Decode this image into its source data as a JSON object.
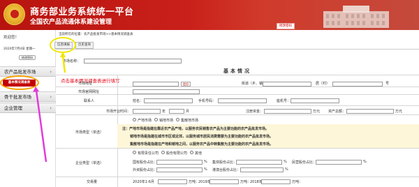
{
  "header": {
    "title_main": "商务部业务系统统一平台",
    "title_sub": "全国农产品流通体系建设管理",
    "header_link": "修改密码"
  },
  "sidebar": {
    "welcome": "欢迎您！",
    "date": "2020年7月4日  星期一",
    "modify_password": "修改密码",
    "items": [
      {
        "label": "农产品批发市场"
      },
      {
        "label": "骨干批发市场"
      },
      {
        "label": "企业管理"
      }
    ],
    "sub_item": "基本情况调查表"
  },
  "main": {
    "breadcrumb": "当前所在的位置：农产品批发市场>>基本情况调查表",
    "tabs": [
      {
        "label": "信息填报"
      },
      {
        "label": "历史查询"
      }
    ],
    "annotation": "点击基本情况调查表进行填写",
    "section_title": "基本情况",
    "form": {
      "market_name": "市场名称：",
      "market_address": "市场地址",
      "locate_btn": "定位",
      "street": "街道（乡、镇）",
      "village": "居（村）",
      "hao": "号",
      "website": "市场官网网址",
      "contact": "联系人",
      "name_lbl": "姓名：",
      "mobile_lbl": "手机号码：",
      "phone_lbl": "座机号：",
      "open_date": "市场开业时间：",
      "year": "年",
      "month": "月",
      "reg_capital": "注册资金：",
      "wan_yuan": "万元",
      "total_assets": "资产总额：",
      "market_type": "市场类型（单选）",
      "types": [
        "产地市场",
        "销地市场",
        "集散地市场"
      ],
      "notes": [
        "注：产地市场是指建在靠近农产品产地，以服务农民销售农产品为主要功能的农产品批发市场。",
        "销地市场是指建在城市市区或近郊，以服务城市居民消费需要为主要功能的农产品批发市场。",
        "集散地市场是指建在产地和销地之间，以服务农产品中转集散为主要功能的农产品批发市场。"
      ],
      "enterprise_type": "企业类型（单选）",
      "enterprise_options": [
        "有限责任公司",
        "股份有限公司",
        "其他"
      ],
      "share_rows": [
        [
          "国有股份占比：",
          "%",
          "集体股份占比：",
          "%",
          "民营股份占比：",
          "%"
        ],
        [
          "外资股份占比：",
          "%",
          "港澳台股份占比：",
          "%"
        ]
      ],
      "trade_volume": "交易量",
      "trade_volume_row": [
        "2020年1-6月",
        "万吨：",
        "2019年",
        "万吨：",
        "2018年",
        "万吨："
      ]
    }
  }
}
